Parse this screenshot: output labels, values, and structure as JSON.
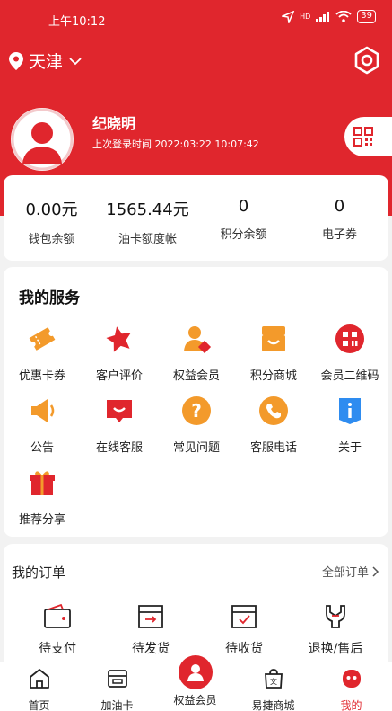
{
  "colors": {
    "brand": "#e0262d",
    "background": "#f2f2f2"
  },
  "status_bar": {
    "time": "上午10:12",
    "network": "HD",
    "battery": "39"
  },
  "header": {
    "city": "天津",
    "settings_icon": "hexagon-gear-icon"
  },
  "user": {
    "name": "纪晓明",
    "last_login": "上次登录时间 2022:03:22 10:07:42",
    "qr_icon": "qr-code-icon"
  },
  "balances": [
    {
      "value": "0.00元",
      "label": "钱包余额"
    },
    {
      "value": "1565.44元",
      "label": "油卡额度帐"
    },
    {
      "value": "0",
      "label": "积分余额"
    },
    {
      "value": "0",
      "label": "电子券"
    }
  ],
  "services": {
    "title": "我的服务",
    "items": [
      {
        "label": "优惠卡券",
        "icon": "ticket-icon"
      },
      {
        "label": "客户评价",
        "icon": "star-icon"
      },
      {
        "label": "权益会员",
        "icon": "member-icon"
      },
      {
        "label": "积分商城",
        "icon": "store-icon"
      },
      {
        "label": "会员二维码",
        "icon": "qr-code-icon"
      },
      {
        "label": "公告",
        "icon": "megaphone-icon"
      },
      {
        "label": "在线客服",
        "icon": "chat-icon"
      },
      {
        "label": "常见问题",
        "icon": "question-icon"
      },
      {
        "label": "客服电话",
        "icon": "phone-icon"
      },
      {
        "label": "关于",
        "icon": "info-icon"
      },
      {
        "label": "推荐分享",
        "icon": "gift-icon"
      }
    ]
  },
  "orders": {
    "title": "我的订单",
    "all_label": "全部订单",
    "items": [
      {
        "label": "待支付",
        "icon": "wallet-icon"
      },
      {
        "label": "待发货",
        "icon": "box-send-icon"
      },
      {
        "label": "待收货",
        "icon": "box-check-icon"
      },
      {
        "label": "退换/售后",
        "icon": "wrench-icon"
      }
    ]
  },
  "tabs": [
    {
      "label": "首页",
      "icon": "home-icon",
      "active": false
    },
    {
      "label": "加油卡",
      "icon": "card-icon",
      "active": false
    },
    {
      "label": "权益会员",
      "icon": "member-icon",
      "active": false
    },
    {
      "label": "易捷商城",
      "icon": "shop-bag-icon",
      "active": false
    },
    {
      "label": "我的",
      "icon": "profile-icon",
      "active": true
    }
  ]
}
